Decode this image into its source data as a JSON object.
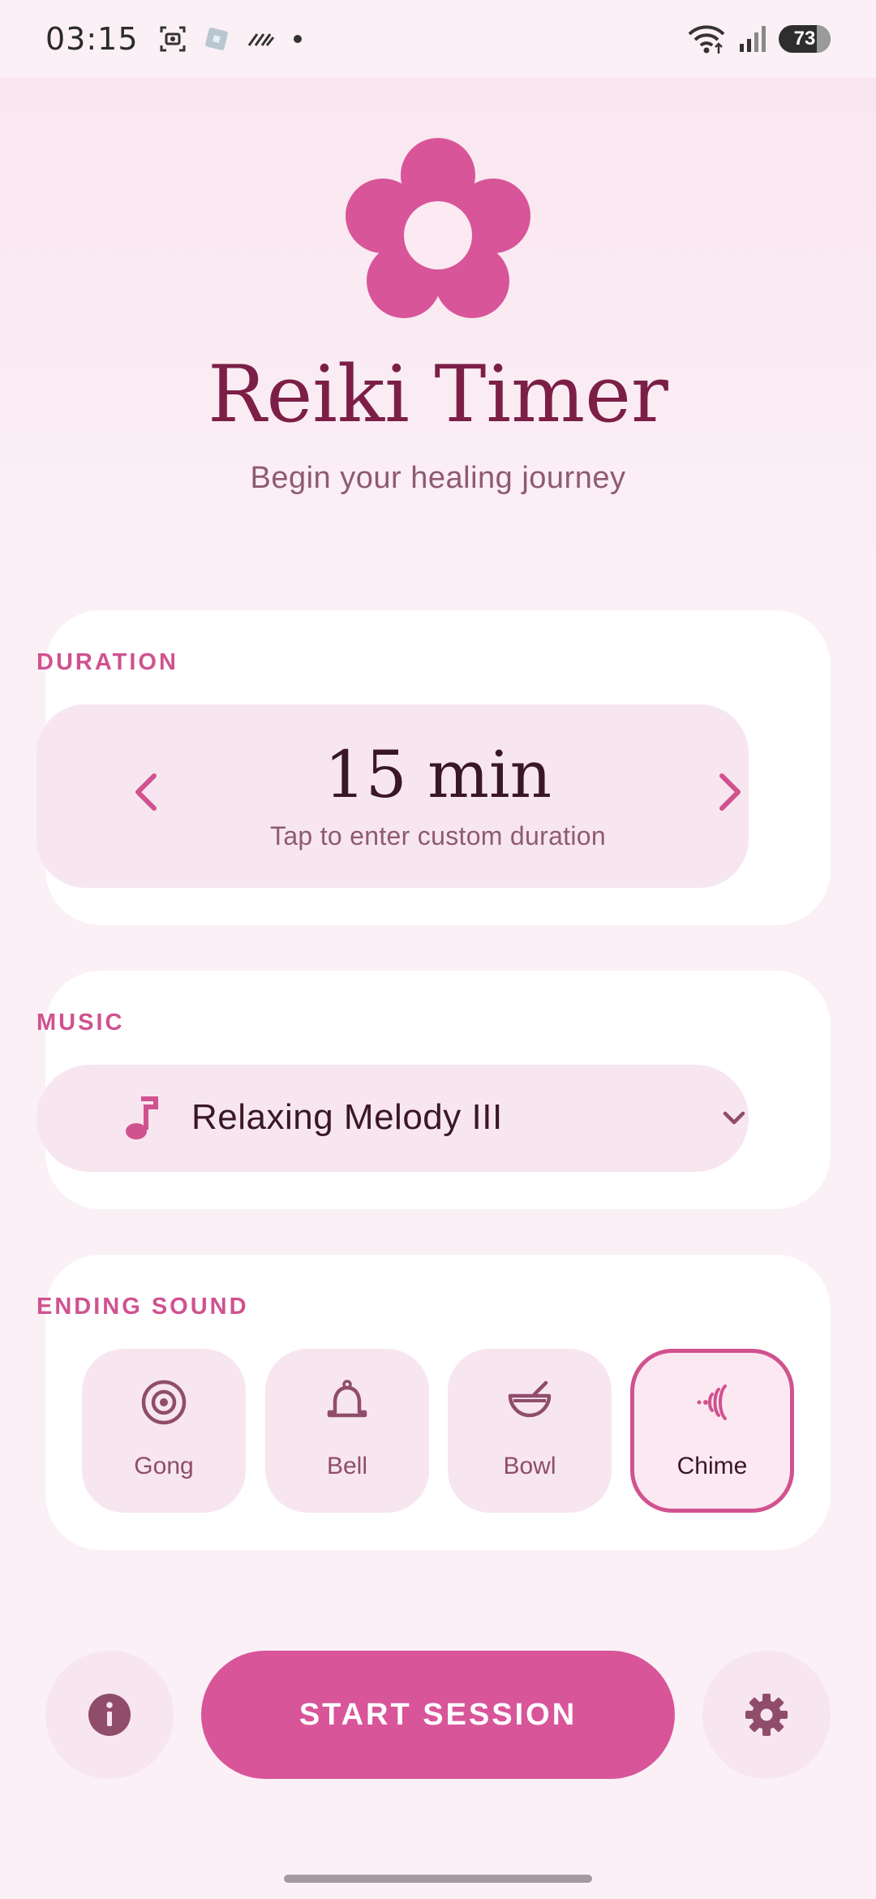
{
  "status_bar": {
    "time": "03:15",
    "battery": "73",
    "battery_level": 0.73,
    "icons_left": [
      "screenshot-icon",
      "app-icon",
      "data-saver-icon",
      "dot-icon"
    ],
    "icons_right": [
      "wifi-icon",
      "signal-icon",
      "battery-icon"
    ]
  },
  "header": {
    "title": "Reiki Timer",
    "subtitle": "Begin your healing journey",
    "logo_icon": "flower-icon"
  },
  "duration": {
    "label": "DURATION",
    "value": "15 min",
    "hint": "Tap to enter custom duration",
    "decrease_icon": "chevron-left-icon",
    "increase_icon": "chevron-right-icon"
  },
  "music": {
    "label": "MUSIC",
    "selected": "Relaxing Melody III",
    "icon": "music-note-icon",
    "dropdown_icon": "chevron-down-icon"
  },
  "ending_sound": {
    "label": "ENDING SOUND",
    "options": [
      {
        "label": "Gong",
        "icon": "gong-icon",
        "selected": false
      },
      {
        "label": "Bell",
        "icon": "bell-icon",
        "selected": false
      },
      {
        "label": "Bowl",
        "icon": "bowl-icon",
        "selected": false
      },
      {
        "label": "Chime",
        "icon": "chime-icon",
        "selected": true
      }
    ]
  },
  "actions": {
    "start": "START SESSION",
    "info_icon": "info-icon",
    "settings_icon": "gear-icon"
  },
  "colors": {
    "accent": "#d8559a",
    "title": "#7c1f47",
    "background": "#fbf0f5",
    "card": "#ffffff",
    "chip": "#f7e6ef"
  }
}
